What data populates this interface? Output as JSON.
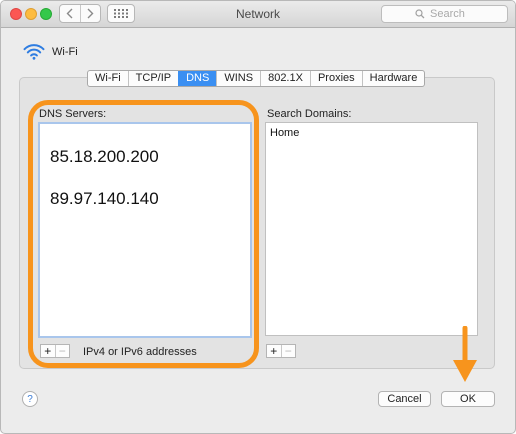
{
  "window": {
    "title": "Network"
  },
  "search": {
    "placeholder": "Search"
  },
  "header": {
    "interface_name": "Wi-Fi"
  },
  "tabs": [
    {
      "label": "Wi-Fi",
      "active": false
    },
    {
      "label": "TCP/IP",
      "active": false
    },
    {
      "label": "DNS",
      "active": true
    },
    {
      "label": "WINS",
      "active": false
    },
    {
      "label": "802.1X",
      "active": false
    },
    {
      "label": "Proxies",
      "active": false
    },
    {
      "label": "Hardware",
      "active": false
    }
  ],
  "dns": {
    "label": "DNS Servers:",
    "servers": [
      "85.18.200.200",
      "89.97.140.140"
    ],
    "add": "+",
    "remove": "−",
    "hint": "IPv4 or IPv6 addresses"
  },
  "domains": {
    "label": "Search Domains:",
    "items": [
      "Home"
    ],
    "add": "+",
    "remove": "−"
  },
  "footer": {
    "help": "?",
    "cancel": "Cancel",
    "ok": "OK"
  },
  "colors": {
    "highlight": "#f7941d",
    "active_tab": "#3a8ff2",
    "close": "#fc5753",
    "minimize": "#fdbc40",
    "zoom": "#34c84a"
  },
  "icons": {
    "back": "chevron-left-icon",
    "forward": "chevron-right-icon",
    "show_all": "grid-icon",
    "search": "magnifier-icon",
    "wifi": "wifi-icon",
    "annotation_arrow": "arrow-down-icon"
  }
}
